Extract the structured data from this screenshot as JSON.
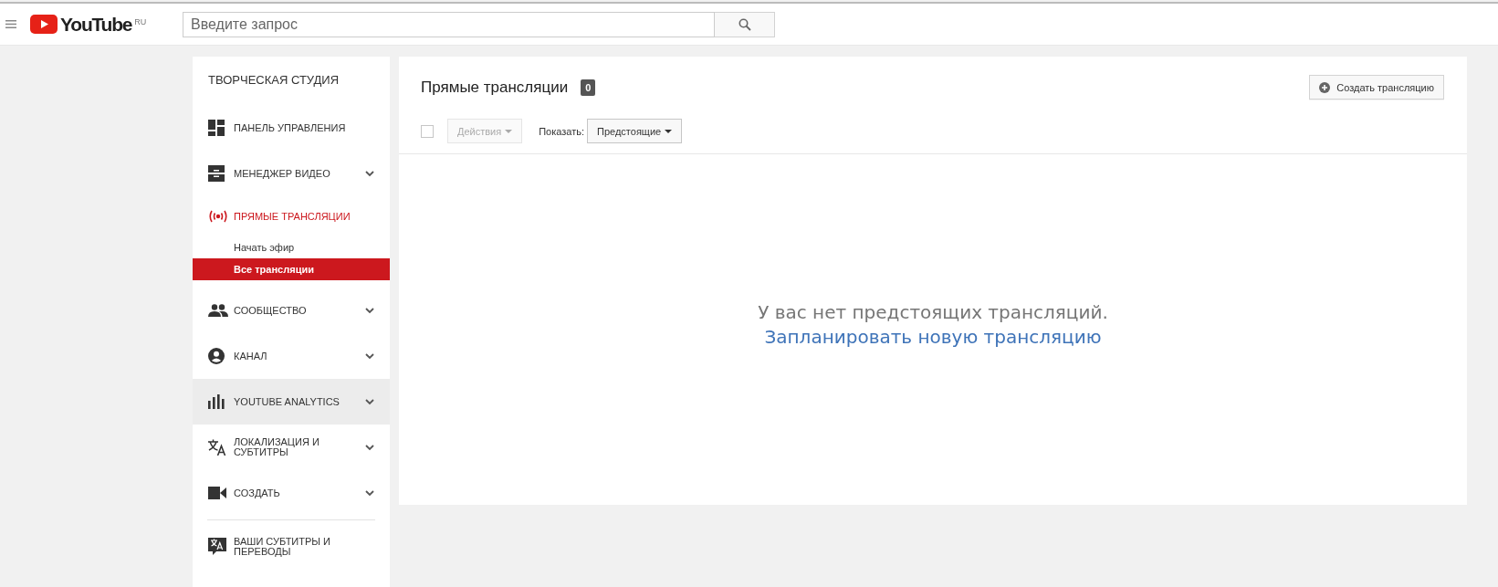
{
  "header": {
    "logo_text": "YouTube",
    "region": "RU",
    "search": {
      "placeholder": "Введите запрос"
    }
  },
  "sidebar": {
    "title": "ТВОРЧЕСКАЯ СТУДИЯ",
    "items": [
      {
        "kind": "nav",
        "label": "ПАНЕЛЬ УПРАВЛЕНИЯ",
        "has_submenu": false,
        "active": false,
        "hovered": false
      },
      {
        "kind": "nav",
        "label": "МЕНЕДЖЕР ВИДЕО",
        "has_submenu": true,
        "active": false,
        "hovered": false
      },
      {
        "kind": "nav",
        "label": "ПРЯМЫЕ ТРАНСЛЯЦИИ",
        "has_submenu": false,
        "active": true,
        "hovered": false
      },
      {
        "kind": "sub",
        "label": "Начать эфир",
        "selected": false
      },
      {
        "kind": "sub",
        "label": "Все трансляции",
        "selected": true
      },
      {
        "kind": "nav",
        "label": "СООБЩЕСТВО",
        "has_submenu": true,
        "active": false,
        "hovered": false
      },
      {
        "kind": "nav",
        "label": "КАНАЛ",
        "has_submenu": true,
        "active": false,
        "hovered": false
      },
      {
        "kind": "nav",
        "label": "YOUTUBE ANALYTICS",
        "has_submenu": true,
        "active": false,
        "hovered": true
      },
      {
        "kind": "nav",
        "label": "ЛОКАЛИЗАЦИЯ И СУБТИТРЫ",
        "has_submenu": true,
        "active": false,
        "hovered": false
      },
      {
        "kind": "nav",
        "label": "СОЗДАТЬ",
        "has_submenu": true,
        "active": false,
        "hovered": false
      },
      {
        "kind": "divider"
      },
      {
        "kind": "nav",
        "label": "ВАШИ СУБТИТРЫ И ПЕРЕВОДЫ",
        "has_submenu": false,
        "active": false,
        "hovered": false
      }
    ]
  },
  "main": {
    "title": "Прямые трансляции",
    "count": "0",
    "create_button": "Создать трансляцию",
    "toolbar": {
      "select_all_checked": false,
      "actions": {
        "label": "Действия",
        "disabled": true
      },
      "show_label": "Показать:",
      "filter": "Предстоящие"
    },
    "empty_message": "У вас нет предстоящих трансляций.",
    "schedule_link": "Запланировать новую трансляцию"
  }
}
